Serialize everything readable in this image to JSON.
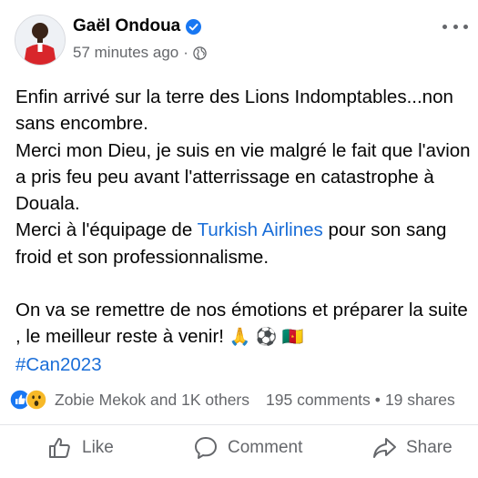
{
  "header": {
    "name": "Gaël Ondoua",
    "timestamp": "57 minutes ago",
    "separator": "·"
  },
  "post": {
    "line1": "Enfin arrivé sur la terre des Lions Indomptables...non sans encombre.",
    "line2": "Merci mon Dieu, je suis en vie malgré le fait que l'avion a pris feu peu avant l'atterrissage en catastrophe à Douala.",
    "line3_before": "Merci à  l'équipage de ",
    "line3_link": "Turkish Airlines",
    "line3_after": "  pour son sang froid et son professionnalisme.",
    "line4": "On va se remettre de nos émotions et préparer la suite , le meilleur reste à venir!",
    "emojis": "🙏 ⚽ 🇨🇲",
    "hashtag": "#Can2023"
  },
  "stats": {
    "reactions_text": "Zobie Mekok and 1K others",
    "comments": "195 comments",
    "dot": "•",
    "shares": "19 shares"
  },
  "actions": {
    "like": "Like",
    "comment": "Comment",
    "share": "Share"
  },
  "colors": {
    "link": "#1a6ed8",
    "verified": "#1877f2",
    "muted": "#65676b",
    "like_reaction": "#1877f2",
    "wow_reaction": "#f7b928"
  },
  "icons": {
    "verified": "verified-badge-icon",
    "globe": "globe-icon",
    "more": "more-options-icon",
    "like_reaction": "like-reaction-icon",
    "wow_reaction": "wow-reaction-icon",
    "like_action": "thumbs-up-icon",
    "comment_action": "comment-bubble-icon",
    "share_action": "share-arrow-icon"
  }
}
